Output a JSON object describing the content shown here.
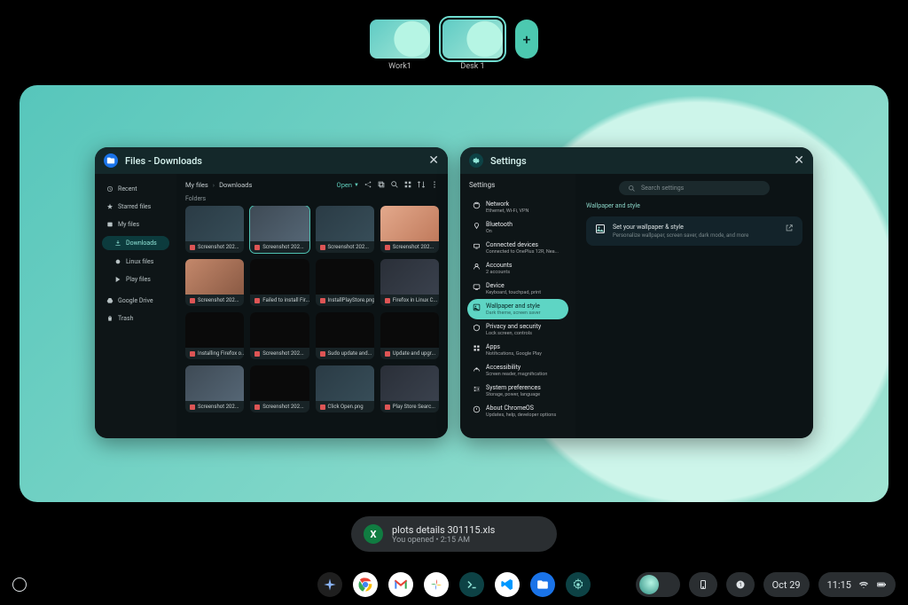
{
  "desks": [
    {
      "label": "Work1",
      "active": false
    },
    {
      "label": "Desk 1",
      "active": true
    }
  ],
  "files_window": {
    "title": "Files - Downloads",
    "breadcrumb": [
      "My files",
      "Downloads"
    ],
    "open_label": "Open",
    "folders_label": "Folders",
    "sidebar": {
      "recent": "Recent",
      "starred": "Starred files",
      "myfiles": "My files",
      "downloads": "Downloads",
      "linux": "Linux files",
      "play": "Play files",
      "drive": "Google Drive",
      "trash": "Trash"
    },
    "files": [
      "Screenshot 202...",
      "Screenshot 202...",
      "Screenshot 202...",
      "Screenshot 202...",
      "Screenshot 202...",
      "Failed to install Fir...",
      "InstallPlayStore.png",
      "Firefox in Linux C...",
      "Installing Firefox o...",
      "Screenshot 202...",
      "Sudo update and...",
      "Update and upgr...",
      "Screenshot 202...",
      "Screenshot 202...",
      "Click Open.png",
      "Play Store Searc..."
    ]
  },
  "settings_window": {
    "title": "Settings",
    "nav_head": "Settings",
    "search_placeholder": "Search settings",
    "section": "Wallpaper and style",
    "card": {
      "title": "Set your wallpaper & style",
      "sub": "Personalize wallpaper, screen saver, dark mode, and more"
    },
    "nav": [
      {
        "label": "Network",
        "sub": "Ethernet, Wi-Fi, VPN"
      },
      {
        "label": "Bluetooth",
        "sub": "On"
      },
      {
        "label": "Connected devices",
        "sub": "Connected to OnePlus 12R, Nea..."
      },
      {
        "label": "Accounts",
        "sub": "2 accounts"
      },
      {
        "label": "Device",
        "sub": "Keyboard, touchpad, print"
      },
      {
        "label": "Wallpaper and style",
        "sub": "Dark theme, screen saver",
        "selected": true
      },
      {
        "label": "Privacy and security",
        "sub": "Lock screen, controls"
      },
      {
        "label": "Apps",
        "sub": "Notifications, Google Play"
      },
      {
        "label": "Accessibility",
        "sub": "Screen reader, magnification"
      },
      {
        "label": "System preferences",
        "sub": "Storage, power, language"
      },
      {
        "label": "About ChromeOS",
        "sub": "Updates, help, developer options"
      }
    ]
  },
  "notification": {
    "title": "plots details 301115.xls",
    "sub": "You opened • 2:15 AM",
    "badge": "X"
  },
  "shelf": {
    "date": "Oct 29",
    "time": "11:15"
  }
}
